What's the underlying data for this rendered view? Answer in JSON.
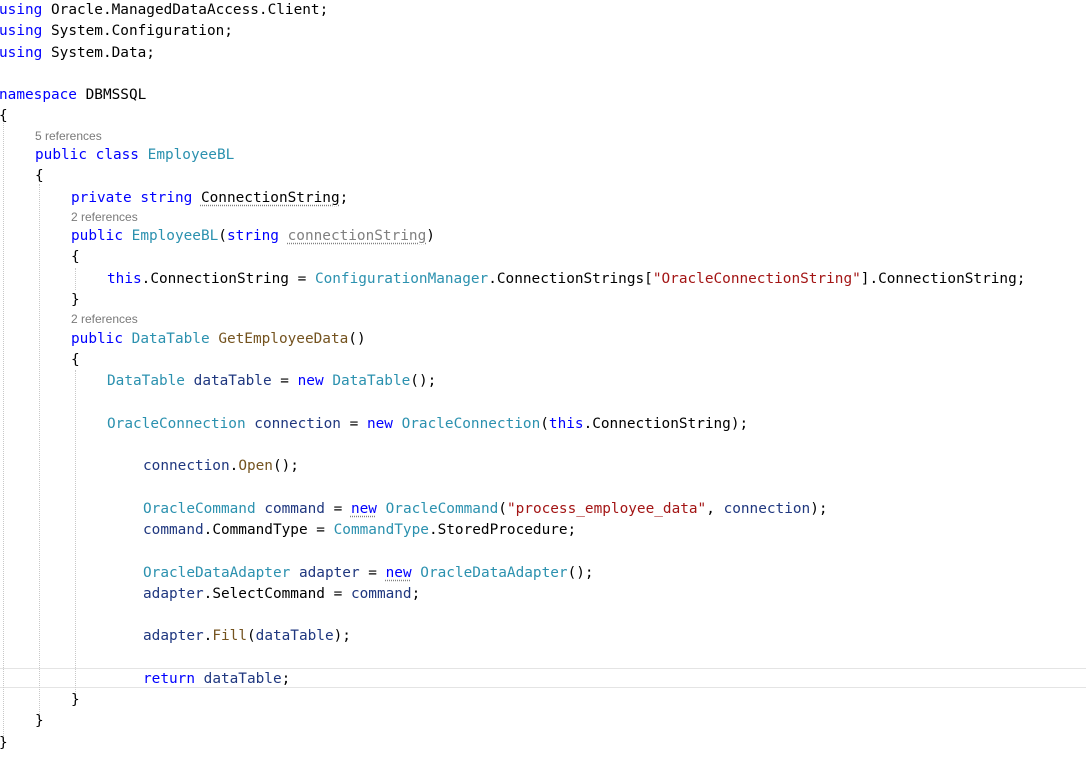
{
  "code_lines": [
    {
      "indent": 0,
      "tokens": [
        {
          "t": "using",
          "c": "kw"
        },
        {
          "t": " Oracle.ManagedDataAccess.Client;",
          "c": "tx"
        }
      ]
    },
    {
      "indent": 0,
      "tokens": [
        {
          "t": "using",
          "c": "kw"
        },
        {
          "t": " System.Configuration;",
          "c": "tx"
        }
      ]
    },
    {
      "indent": 0,
      "tokens": [
        {
          "t": "using",
          "c": "kw"
        },
        {
          "t": " System.Data;",
          "c": "tx"
        }
      ]
    },
    {
      "indent": 0,
      "tokens": []
    },
    {
      "indent": 0,
      "tokens": [
        {
          "t": "namespace",
          "c": "kw"
        },
        {
          "t": " DBMSSQL",
          "c": "tx"
        }
      ]
    },
    {
      "indent": 0,
      "tokens": [
        {
          "t": "{",
          "c": "tx"
        }
      ]
    },
    {
      "indent": 1,
      "tokens": [
        {
          "t": "public",
          "c": "kw"
        },
        {
          "t": " ",
          "c": "tx"
        },
        {
          "t": "class",
          "c": "kw"
        },
        {
          "t": " ",
          "c": "tx"
        },
        {
          "t": "EmployeeBL",
          "c": "ty"
        }
      ]
    },
    {
      "indent": 1,
      "tokens": [
        {
          "t": "{",
          "c": "tx"
        }
      ]
    },
    {
      "indent": 2,
      "tokens": [
        {
          "t": "private",
          "c": "kw"
        },
        {
          "t": " ",
          "c": "tx"
        },
        {
          "t": "string",
          "c": "kw"
        },
        {
          "t": " ",
          "c": "tx"
        },
        {
          "t": "ConnectionString",
          "c": "tx",
          "d": true
        },
        {
          "t": ";",
          "c": "tx"
        }
      ]
    },
    {
      "indent": 2,
      "tokens": [
        {
          "t": "public",
          "c": "kw"
        },
        {
          "t": " ",
          "c": "tx"
        },
        {
          "t": "EmployeeBL",
          "c": "ty"
        },
        {
          "t": "(",
          "c": "tx"
        },
        {
          "t": "string",
          "c": "kw"
        },
        {
          "t": " ",
          "c": "tx"
        },
        {
          "t": "connectionString",
          "c": "pa",
          "d": true
        },
        {
          "t": ")",
          "c": "tx"
        }
      ]
    },
    {
      "indent": 2,
      "tokens": [
        {
          "t": "{",
          "c": "tx"
        }
      ]
    },
    {
      "indent": 3,
      "tokens": [
        {
          "t": "this",
          "c": "kw"
        },
        {
          "t": ".ConnectionString = ",
          "c": "tx"
        },
        {
          "t": "ConfigurationManager",
          "c": "ty"
        },
        {
          "t": ".ConnectionStrings[",
          "c": "tx"
        },
        {
          "t": "\"OracleConnectionString\"",
          "c": "st"
        },
        {
          "t": "].ConnectionString;",
          "c": "tx"
        }
      ]
    },
    {
      "indent": 2,
      "tokens": [
        {
          "t": "}",
          "c": "tx"
        }
      ]
    },
    {
      "indent": 2,
      "tokens": [
        {
          "t": "public",
          "c": "kw"
        },
        {
          "t": " ",
          "c": "tx"
        },
        {
          "t": "DataTable",
          "c": "ty"
        },
        {
          "t": " ",
          "c": "tx"
        },
        {
          "t": "GetEmployeeData",
          "c": "mt"
        },
        {
          "t": "()",
          "c": "tx"
        }
      ]
    },
    {
      "indent": 2,
      "tokens": [
        {
          "t": "{",
          "c": "tx"
        }
      ]
    },
    {
      "indent": 3,
      "tokens": [
        {
          "t": "DataTable",
          "c": "ty"
        },
        {
          "t": " ",
          "c": "tx"
        },
        {
          "t": "dataTable",
          "c": "gd"
        },
        {
          "t": " = ",
          "c": "tx"
        },
        {
          "t": "new",
          "c": "kw"
        },
        {
          "t": " ",
          "c": "tx"
        },
        {
          "t": "DataTable",
          "c": "ty"
        },
        {
          "t": "();",
          "c": "tx"
        }
      ]
    },
    {
      "indent": 3,
      "tokens": []
    },
    {
      "indent": 3,
      "tokens": [
        {
          "t": "OracleConnection",
          "c": "ty"
        },
        {
          "t": " ",
          "c": "tx"
        },
        {
          "t": "connection",
          "c": "gd"
        },
        {
          "t": " = ",
          "c": "tx"
        },
        {
          "t": "new",
          "c": "kw"
        },
        {
          "t": " ",
          "c": "tx"
        },
        {
          "t": "OracleConnection",
          "c": "ty"
        },
        {
          "t": "(",
          "c": "tx"
        },
        {
          "t": "this",
          "c": "kw"
        },
        {
          "t": ".ConnectionString);",
          "c": "tx"
        }
      ]
    },
    {
      "indent": 3,
      "tokens": []
    },
    {
      "indent": 4,
      "tokens": [
        {
          "t": "connection",
          "c": "gd"
        },
        {
          "t": ".",
          "c": "tx"
        },
        {
          "t": "Open",
          "c": "mt"
        },
        {
          "t": "();",
          "c": "tx"
        }
      ]
    },
    {
      "indent": 4,
      "tokens": []
    },
    {
      "indent": 4,
      "tokens": [
        {
          "t": "OracleCommand",
          "c": "ty"
        },
        {
          "t": " ",
          "c": "tx"
        },
        {
          "t": "command",
          "c": "gd"
        },
        {
          "t": " = ",
          "c": "tx"
        },
        {
          "t": "new",
          "c": "kw",
          "d": true
        },
        {
          "t": " ",
          "c": "tx"
        },
        {
          "t": "OracleCommand",
          "c": "ty"
        },
        {
          "t": "(",
          "c": "tx"
        },
        {
          "t": "\"process_employee_data\"",
          "c": "st"
        },
        {
          "t": ", ",
          "c": "tx"
        },
        {
          "t": "connection",
          "c": "gd"
        },
        {
          "t": ");",
          "c": "tx"
        }
      ]
    },
    {
      "indent": 4,
      "tokens": [
        {
          "t": "command",
          "c": "gd"
        },
        {
          "t": ".CommandType = ",
          "c": "tx"
        },
        {
          "t": "CommandType",
          "c": "ty"
        },
        {
          "t": ".StoredProcedure;",
          "c": "tx"
        }
      ]
    },
    {
      "indent": 4,
      "tokens": []
    },
    {
      "indent": 4,
      "tokens": [
        {
          "t": "OracleDataAdapter",
          "c": "ty"
        },
        {
          "t": " ",
          "c": "tx"
        },
        {
          "t": "adapter",
          "c": "gd"
        },
        {
          "t": " = ",
          "c": "tx"
        },
        {
          "t": "new",
          "c": "kw",
          "d": true
        },
        {
          "t": " ",
          "c": "tx"
        },
        {
          "t": "OracleDataAdapter",
          "c": "ty"
        },
        {
          "t": "();",
          "c": "tx"
        }
      ]
    },
    {
      "indent": 4,
      "tokens": [
        {
          "t": "adapter",
          "c": "gd"
        },
        {
          "t": ".SelectCommand = ",
          "c": "tx"
        },
        {
          "t": "command",
          "c": "gd"
        },
        {
          "t": ";",
          "c": "tx"
        }
      ]
    },
    {
      "indent": 4,
      "tokens": []
    },
    {
      "indent": 4,
      "tokens": [
        {
          "t": "adapter",
          "c": "gd"
        },
        {
          "t": ".",
          "c": "tx"
        },
        {
          "t": "Fill",
          "c": "mt"
        },
        {
          "t": "(",
          "c": "tx"
        },
        {
          "t": "dataTable",
          "c": "gd"
        },
        {
          "t": ");",
          "c": "tx"
        }
      ]
    },
    {
      "indent": 4,
      "tokens": []
    },
    {
      "indent": 4,
      "tokens": [
        {
          "t": "return",
          "c": "kw"
        },
        {
          "t": " ",
          "c": "tx"
        },
        {
          "t": "dataTable",
          "c": "gd"
        },
        {
          "t": ";",
          "c": "tx"
        }
      ]
    },
    {
      "indent": 2,
      "tokens": [
        {
          "t": "}",
          "c": "tx"
        }
      ]
    },
    {
      "indent": 1,
      "tokens": [
        {
          "t": "}",
          "c": "tx"
        }
      ]
    },
    {
      "indent": 0,
      "tokens": [
        {
          "t": "}",
          "c": "tx"
        }
      ]
    }
  ],
  "codelens": [
    {
      "text": "5 references",
      "before": 6
    },
    {
      "text": "2 references",
      "before": 9
    },
    {
      "text": "2 references",
      "before": 13
    }
  ],
  "colors": {
    "keyword": "#0000ff",
    "type": "#2b91af",
    "string": "#a31515",
    "text": "#000000",
    "unused_parameter": "#808080",
    "method": "#74531f",
    "local_variable": "#1f377f",
    "codelens": "#7a7a7a",
    "current_line_border": "#e4e4e4"
  }
}
